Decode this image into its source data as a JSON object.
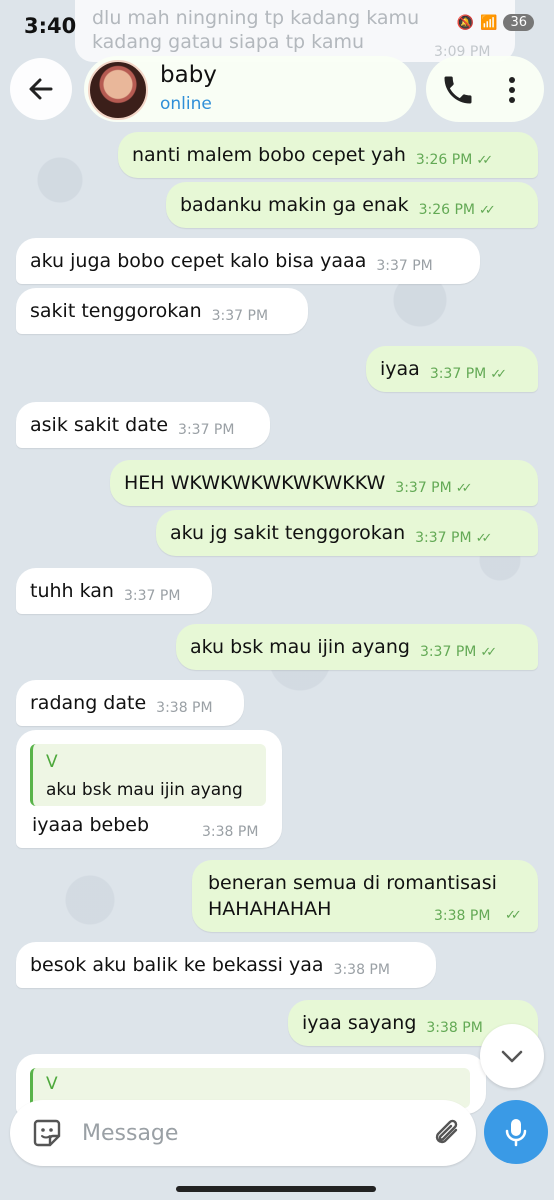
{
  "status_bar": {
    "time": "3:40",
    "battery": "36"
  },
  "background_message": {
    "text": "dlu mah ningning tp kadang kamu kadang gatau siapa tp kamu",
    "time": "3:09 PM"
  },
  "header": {
    "contact_name": "baby",
    "contact_status": "online"
  },
  "messages": [
    {
      "text": "nanti malem bobo cepet yah",
      "time": "3:26 PM"
    },
    {
      "text": "badanku makin ga enak",
      "time": "3:26 PM"
    },
    {
      "text": "aku juga bobo cepet kalo bisa yaaa",
      "time": "3:37 PM"
    },
    {
      "text": "sakit tenggorokan",
      "time": "3:37 PM"
    },
    {
      "text": "iyaa",
      "time": "3:37 PM"
    },
    {
      "text": "asik sakit date",
      "time": "3:37 PM"
    },
    {
      "text": "HEH WKWKWKWKWKWKKW",
      "time": "3:37 PM"
    },
    {
      "text": "aku jg sakit tenggorokan",
      "time": "3:37 PM"
    },
    {
      "text": "tuhh kan",
      "time": "3:37 PM"
    },
    {
      "text": "aku bsk mau ijin ayang",
      "time": "3:37 PM"
    },
    {
      "text": "radang date",
      "time": "3:38 PM"
    },
    {
      "reply_name": "V",
      "reply_text": "aku bsk mau ijin ayang",
      "text": "iyaaa bebeb",
      "time": "3:38 PM"
    },
    {
      "text_line1": "beneran semua di romantisasi",
      "text_line2": "HAHAHAHAH",
      "time": "3:38 PM"
    },
    {
      "text": "besok aku balik ke bekassi yaa",
      "time": "3:38 PM"
    },
    {
      "text": "iyaa sayang",
      "time": "3:38 PM"
    },
    {
      "reply_name": "V"
    }
  ],
  "composer": {
    "placeholder": "Message"
  },
  "colors": {
    "outgoing_bubble": "#e7f8d6",
    "incoming_bubble": "#ffffff",
    "accent": "#3a9ae6",
    "tick": "#63a955"
  },
  "icons": [
    "back-arrow-icon",
    "phone-icon",
    "more-vertical-icon",
    "sticker-icon",
    "paperclip-icon",
    "microphone-icon",
    "chevron-down-icon",
    "double-check-icon"
  ]
}
